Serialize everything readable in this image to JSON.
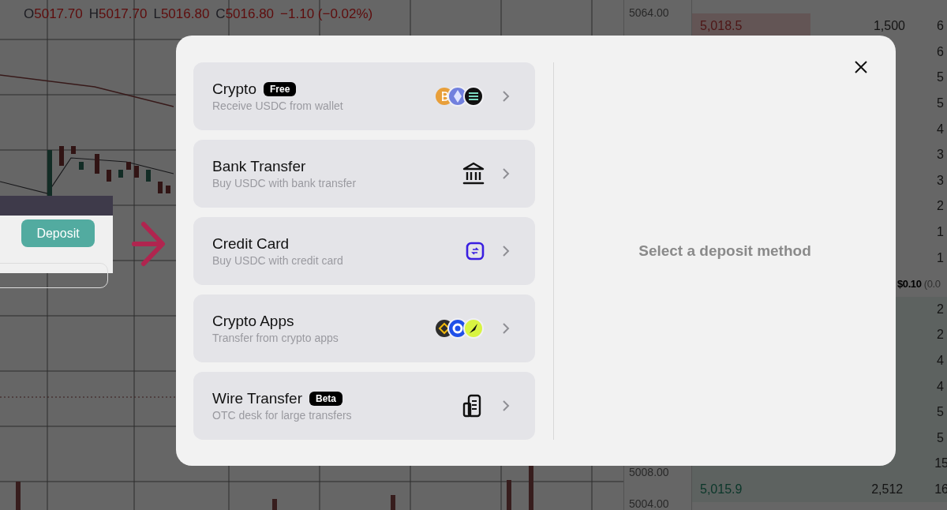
{
  "chart": {
    "ohlc": [
      {
        "label": "O",
        "value": "5017.70"
      },
      {
        "label": "H",
        "value": "5017.70"
      },
      {
        "label": "L",
        "value": "5016.80"
      },
      {
        "label": "C",
        "value": "5016.80"
      }
    ],
    "change": "−1.10 (−0.02%)",
    "axis_labels": [
      "5064.00",
      "5008.00",
      "5004.00"
    ]
  },
  "order_book": {
    "rows": [
      {
        "kind": "ask",
        "price": "5,018.5",
        "size": "1,500",
        "total": "6"
      },
      {
        "kind": "ask",
        "total": "6"
      },
      {
        "kind": "ask",
        "total": "5"
      },
      {
        "kind": "ask",
        "total": "5"
      },
      {
        "kind": "ask",
        "total": "4"
      },
      {
        "kind": "ask",
        "total": "3"
      },
      {
        "kind": "ask",
        "total": "3"
      },
      {
        "kind": "ask",
        "total": "2"
      },
      {
        "kind": "ask",
        "total": "1"
      },
      {
        "kind": "ask",
        "total": "1"
      },
      {
        "kind": "spread",
        "value": "$0.10",
        "note": "(0.0"
      },
      {
        "kind": "bid",
        "total": "2"
      },
      {
        "kind": "bid",
        "total": "2"
      },
      {
        "kind": "bid",
        "total": "4"
      },
      {
        "kind": "bid",
        "total": "4"
      },
      {
        "kind": "bid",
        "total": "5"
      },
      {
        "kind": "bid",
        "total": "5"
      },
      {
        "kind": "bid",
        "total": "15"
      },
      {
        "kind": "bid",
        "price": "5,015.9",
        "size": "2,512",
        "total": "16"
      }
    ]
  },
  "annotation": {
    "button": "Deposit"
  },
  "modal": {
    "methods": [
      {
        "kind": "coins",
        "title": "Crypto",
        "badge": "Free",
        "subtitle": "Receive USDC from wallet"
      },
      {
        "kind": "bank",
        "title": "Bank Transfer",
        "subtitle": "Buy USDC with bank transfer"
      },
      {
        "kind": "card",
        "title": "Credit Card",
        "subtitle": "Buy USDC with credit card"
      },
      {
        "kind": "apps",
        "title": "Crypto Apps",
        "subtitle": "Transfer from crypto apps"
      },
      {
        "kind": "building",
        "title": "Wire Transfer",
        "badge": "Beta",
        "subtitle": "OTC desk for large transfers"
      }
    ],
    "placeholder": "Select a deposit method"
  }
}
